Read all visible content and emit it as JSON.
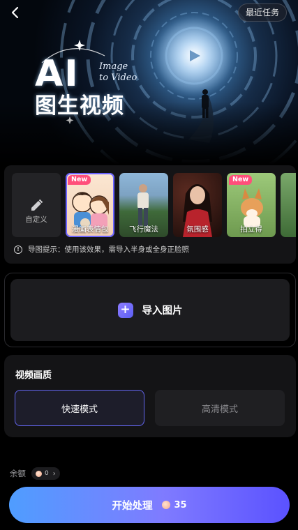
{
  "header": {
    "recent_tasks_label": "最近任务"
  },
  "hero": {
    "title_main": "AI",
    "title_sub": "图生视频",
    "script_line1": "Image",
    "script_line2": "to Video"
  },
  "effects": {
    "items": [
      {
        "label": "自定义",
        "badge": ""
      },
      {
        "label": "漫画表情包",
        "badge": "New"
      },
      {
        "label": "飞行魔法",
        "badge": ""
      },
      {
        "label": "氛围感",
        "badge": ""
      },
      {
        "label": "拍立得",
        "badge": "New"
      },
      {
        "label": "",
        "badge": ""
      }
    ],
    "tip": "导图提示：使用该效果，需导入半身或全身正脸照"
  },
  "import": {
    "label": "导入图片",
    "plus_symbol": "+"
  },
  "quality": {
    "title": "视频画质",
    "fast_label": "快速模式",
    "hd_label": "高清模式"
  },
  "balance": {
    "label": "余额",
    "value": "0"
  },
  "start": {
    "label": "开始处理",
    "cost": "35"
  },
  "colors": {
    "accent": "#6366f1",
    "badge": "#ff4f7b"
  }
}
